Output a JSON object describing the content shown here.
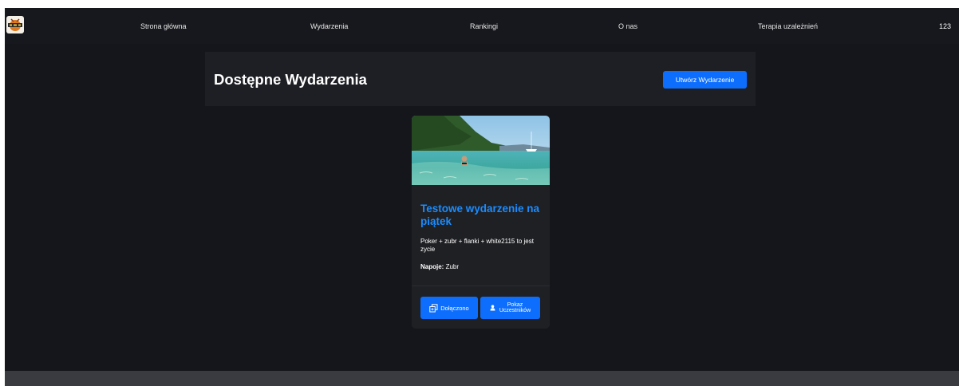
{
  "navbar": {
    "logo_icon": "pub-logo-icon",
    "links": [
      {
        "label": "Strona główna"
      },
      {
        "label": "Wydarzenia"
      },
      {
        "label": "Rankingi"
      },
      {
        "label": "O nas"
      },
      {
        "label": "Terapia uzależnień"
      }
    ],
    "user": "123"
  },
  "header": {
    "title": "Dostępne Wydarzenia",
    "create_button": "Utwórz Wydarzenie"
  },
  "events": [
    {
      "image_icon": "sea-photo",
      "title": "Testowe wydarzenie na piątek",
      "description": "Poker + zubr + flanki + white2115 to jest zycie",
      "drinks_label": "Napoje:",
      "drinks_value": " Zubr",
      "joined_button": "Dołączono",
      "joined_icon": "copy-icon",
      "participants_button": "Pokaz Uczestników",
      "participants_icon": "user-icon"
    }
  ],
  "colors": {
    "background": "#15161b",
    "navbar": "#17181d",
    "panel": "#1e1f24",
    "card": "#1f2024",
    "accent": "#0d6efd",
    "title_blue": "#1a8cff",
    "footer": "#3a3b40"
  }
}
